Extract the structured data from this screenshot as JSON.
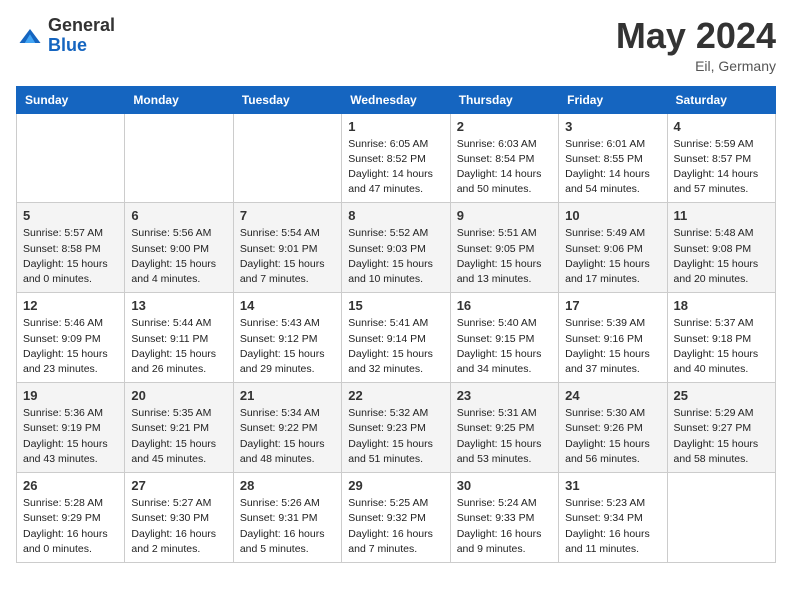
{
  "header": {
    "logo": {
      "general": "General",
      "blue": "Blue"
    },
    "title": "May 2024",
    "location": "Eil, Germany"
  },
  "weekdays": [
    "Sunday",
    "Monday",
    "Tuesday",
    "Wednesday",
    "Thursday",
    "Friday",
    "Saturday"
  ],
  "weeks": [
    [
      {
        "day": "",
        "sunrise": "",
        "sunset": "",
        "daylight": ""
      },
      {
        "day": "",
        "sunrise": "",
        "sunset": "",
        "daylight": ""
      },
      {
        "day": "",
        "sunrise": "",
        "sunset": "",
        "daylight": ""
      },
      {
        "day": "1",
        "sunrise": "Sunrise: 6:05 AM",
        "sunset": "Sunset: 8:52 PM",
        "daylight": "Daylight: 14 hours and 47 minutes."
      },
      {
        "day": "2",
        "sunrise": "Sunrise: 6:03 AM",
        "sunset": "Sunset: 8:54 PM",
        "daylight": "Daylight: 14 hours and 50 minutes."
      },
      {
        "day": "3",
        "sunrise": "Sunrise: 6:01 AM",
        "sunset": "Sunset: 8:55 PM",
        "daylight": "Daylight: 14 hours and 54 minutes."
      },
      {
        "day": "4",
        "sunrise": "Sunrise: 5:59 AM",
        "sunset": "Sunset: 8:57 PM",
        "daylight": "Daylight: 14 hours and 57 minutes."
      }
    ],
    [
      {
        "day": "5",
        "sunrise": "Sunrise: 5:57 AM",
        "sunset": "Sunset: 8:58 PM",
        "daylight": "Daylight: 15 hours and 0 minutes."
      },
      {
        "day": "6",
        "sunrise": "Sunrise: 5:56 AM",
        "sunset": "Sunset: 9:00 PM",
        "daylight": "Daylight: 15 hours and 4 minutes."
      },
      {
        "day": "7",
        "sunrise": "Sunrise: 5:54 AM",
        "sunset": "Sunset: 9:01 PM",
        "daylight": "Daylight: 15 hours and 7 minutes."
      },
      {
        "day": "8",
        "sunrise": "Sunrise: 5:52 AM",
        "sunset": "Sunset: 9:03 PM",
        "daylight": "Daylight: 15 hours and 10 minutes."
      },
      {
        "day": "9",
        "sunrise": "Sunrise: 5:51 AM",
        "sunset": "Sunset: 9:05 PM",
        "daylight": "Daylight: 15 hours and 13 minutes."
      },
      {
        "day": "10",
        "sunrise": "Sunrise: 5:49 AM",
        "sunset": "Sunset: 9:06 PM",
        "daylight": "Daylight: 15 hours and 17 minutes."
      },
      {
        "day": "11",
        "sunrise": "Sunrise: 5:48 AM",
        "sunset": "Sunset: 9:08 PM",
        "daylight": "Daylight: 15 hours and 20 minutes."
      }
    ],
    [
      {
        "day": "12",
        "sunrise": "Sunrise: 5:46 AM",
        "sunset": "Sunset: 9:09 PM",
        "daylight": "Daylight: 15 hours and 23 minutes."
      },
      {
        "day": "13",
        "sunrise": "Sunrise: 5:44 AM",
        "sunset": "Sunset: 9:11 PM",
        "daylight": "Daylight: 15 hours and 26 minutes."
      },
      {
        "day": "14",
        "sunrise": "Sunrise: 5:43 AM",
        "sunset": "Sunset: 9:12 PM",
        "daylight": "Daylight: 15 hours and 29 minutes."
      },
      {
        "day": "15",
        "sunrise": "Sunrise: 5:41 AM",
        "sunset": "Sunset: 9:14 PM",
        "daylight": "Daylight: 15 hours and 32 minutes."
      },
      {
        "day": "16",
        "sunrise": "Sunrise: 5:40 AM",
        "sunset": "Sunset: 9:15 PM",
        "daylight": "Daylight: 15 hours and 34 minutes."
      },
      {
        "day": "17",
        "sunrise": "Sunrise: 5:39 AM",
        "sunset": "Sunset: 9:16 PM",
        "daylight": "Daylight: 15 hours and 37 minutes."
      },
      {
        "day": "18",
        "sunrise": "Sunrise: 5:37 AM",
        "sunset": "Sunset: 9:18 PM",
        "daylight": "Daylight: 15 hours and 40 minutes."
      }
    ],
    [
      {
        "day": "19",
        "sunrise": "Sunrise: 5:36 AM",
        "sunset": "Sunset: 9:19 PM",
        "daylight": "Daylight: 15 hours and 43 minutes."
      },
      {
        "day": "20",
        "sunrise": "Sunrise: 5:35 AM",
        "sunset": "Sunset: 9:21 PM",
        "daylight": "Daylight: 15 hours and 45 minutes."
      },
      {
        "day": "21",
        "sunrise": "Sunrise: 5:34 AM",
        "sunset": "Sunset: 9:22 PM",
        "daylight": "Daylight: 15 hours and 48 minutes."
      },
      {
        "day": "22",
        "sunrise": "Sunrise: 5:32 AM",
        "sunset": "Sunset: 9:23 PM",
        "daylight": "Daylight: 15 hours and 51 minutes."
      },
      {
        "day": "23",
        "sunrise": "Sunrise: 5:31 AM",
        "sunset": "Sunset: 9:25 PM",
        "daylight": "Daylight: 15 hours and 53 minutes."
      },
      {
        "day": "24",
        "sunrise": "Sunrise: 5:30 AM",
        "sunset": "Sunset: 9:26 PM",
        "daylight": "Daylight: 15 hours and 56 minutes."
      },
      {
        "day": "25",
        "sunrise": "Sunrise: 5:29 AM",
        "sunset": "Sunset: 9:27 PM",
        "daylight": "Daylight: 15 hours and 58 minutes."
      }
    ],
    [
      {
        "day": "26",
        "sunrise": "Sunrise: 5:28 AM",
        "sunset": "Sunset: 9:29 PM",
        "daylight": "Daylight: 16 hours and 0 minutes."
      },
      {
        "day": "27",
        "sunrise": "Sunrise: 5:27 AM",
        "sunset": "Sunset: 9:30 PM",
        "daylight": "Daylight: 16 hours and 2 minutes."
      },
      {
        "day": "28",
        "sunrise": "Sunrise: 5:26 AM",
        "sunset": "Sunset: 9:31 PM",
        "daylight": "Daylight: 16 hours and 5 minutes."
      },
      {
        "day": "29",
        "sunrise": "Sunrise: 5:25 AM",
        "sunset": "Sunset: 9:32 PM",
        "daylight": "Daylight: 16 hours and 7 minutes."
      },
      {
        "day": "30",
        "sunrise": "Sunrise: 5:24 AM",
        "sunset": "Sunset: 9:33 PM",
        "daylight": "Daylight: 16 hours and 9 minutes."
      },
      {
        "day": "31",
        "sunrise": "Sunrise: 5:23 AM",
        "sunset": "Sunset: 9:34 PM",
        "daylight": "Daylight: 16 hours and 11 minutes."
      },
      {
        "day": "",
        "sunrise": "",
        "sunset": "",
        "daylight": ""
      }
    ]
  ]
}
